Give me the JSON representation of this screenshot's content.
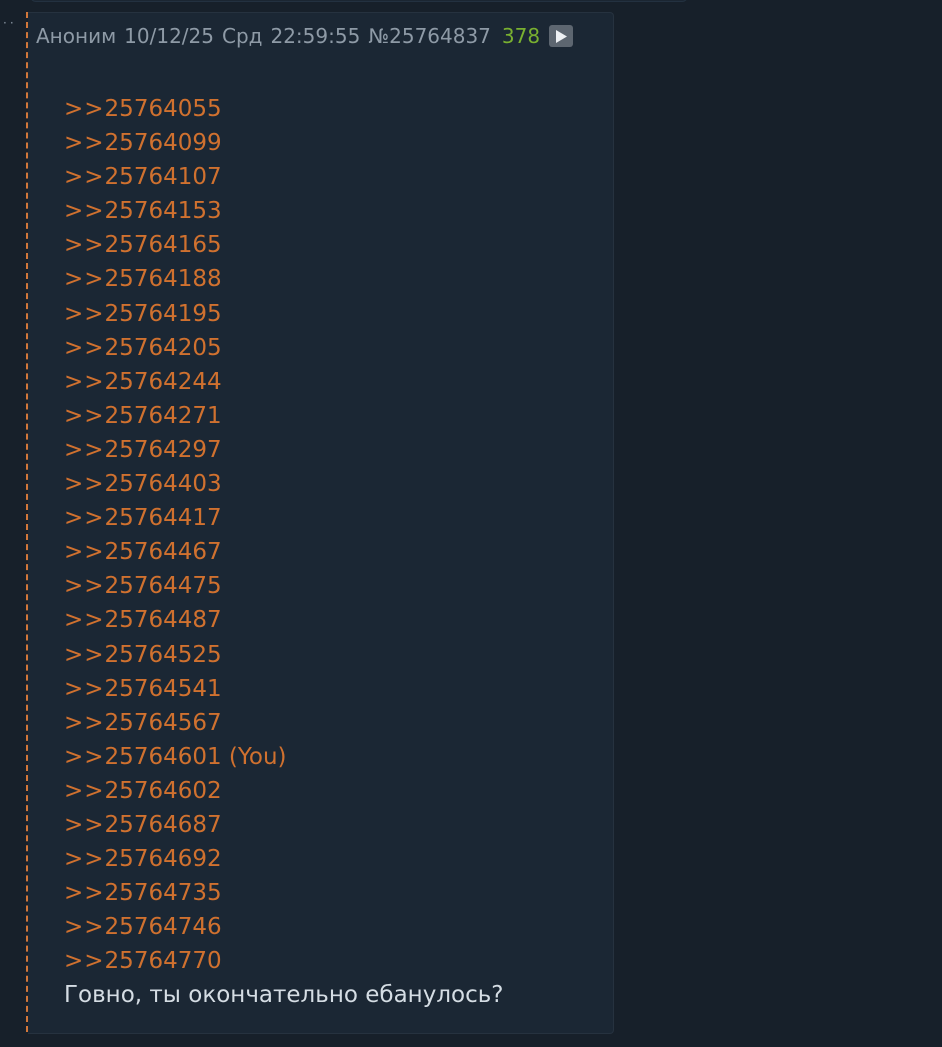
{
  "post": {
    "author": "Аноним",
    "date": "10/12/25",
    "weekday": "Срд",
    "time": "22:59:55",
    "number": "№25764837",
    "replies_count": "378",
    "play_icon": "play-icon",
    "reply_links": [
      {
        "text": "25764055",
        "suffix": ""
      },
      {
        "text": "25764099",
        "suffix": ""
      },
      {
        "text": "25764107",
        "suffix": ""
      },
      {
        "text": "25764153",
        "suffix": ""
      },
      {
        "text": "25764165",
        "suffix": ""
      },
      {
        "text": "25764188",
        "suffix": ""
      },
      {
        "text": "25764195",
        "suffix": ""
      },
      {
        "text": "25764205",
        "suffix": ""
      },
      {
        "text": "25764244",
        "suffix": ""
      },
      {
        "text": "25764271",
        "suffix": ""
      },
      {
        "text": "25764297",
        "suffix": ""
      },
      {
        "text": "25764403",
        "suffix": ""
      },
      {
        "text": "25764417",
        "suffix": ""
      },
      {
        "text": "25764467",
        "suffix": ""
      },
      {
        "text": "25764475",
        "suffix": ""
      },
      {
        "text": "25764487",
        "suffix": ""
      },
      {
        "text": "25764525",
        "suffix": ""
      },
      {
        "text": "25764541",
        "suffix": ""
      },
      {
        "text": "25764567",
        "suffix": ""
      },
      {
        "text": "25764601",
        "suffix": " (You)"
      },
      {
        "text": "25764602",
        "suffix": ""
      },
      {
        "text": "25764687",
        "suffix": ""
      },
      {
        "text": "25764692",
        "suffix": ""
      },
      {
        "text": "25764735",
        "suffix": ""
      },
      {
        "text": "25764746",
        "suffix": ""
      },
      {
        "text": "25764770",
        "suffix": ""
      }
    ],
    "link_prefix": ">>",
    "message": "Говно, ты окончательно ебанулось?"
  },
  "colors": {
    "background": "#17202a",
    "post_background": "#1b2734",
    "link": "#d0712f",
    "header_text": "#8e9aa6",
    "reply_count": "#79b030",
    "message_text": "#d5dde4",
    "thread_line": "#d2773a"
  }
}
